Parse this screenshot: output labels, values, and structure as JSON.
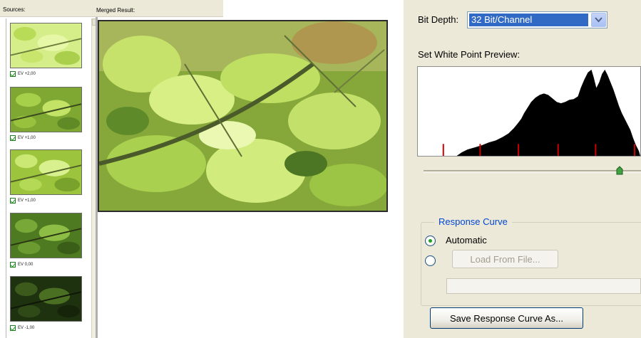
{
  "sources_panel": {
    "sources_label": "Sources:",
    "merged_label": "Merged Result:",
    "thumbnails": [
      {
        "ev_label": "EV +2,00",
        "checked": true,
        "exposure": "brightest"
      },
      {
        "ev_label": "EV +1,00",
        "checked": true,
        "exposure": "bright"
      },
      {
        "ev_label": "EV +1,00",
        "checked": true,
        "exposure": "bright"
      },
      {
        "ev_label": "EV 0,00",
        "checked": true,
        "exposure": "normal"
      },
      {
        "ev_label": "EV -1,00",
        "checked": true,
        "exposure": "dark"
      }
    ]
  },
  "options": {
    "bit_depth_label": "Bit Depth:",
    "bit_depth_value": "32 Bit/Channel",
    "white_point_label": "Set White Point Preview:",
    "white_point_fraction": 0.9,
    "response_curve": {
      "title": "Response Curve",
      "automatic_label": "Automatic",
      "automatic_selected": true,
      "load_from_file_label": "Load From File...",
      "load_from_file_enabled": false,
      "file_path_value": "",
      "save_button_label": "Save Response Curve As..."
    }
  },
  "colors": {
    "dialog_bg": "#ece9d8",
    "selection_blue": "#316ac5",
    "group_title_blue": "#0046d5",
    "histogram_fill": "#000000",
    "histogram_markers": "#cc0000",
    "foliage_light": "#c7e26a",
    "foliage_dark": "#3f5d1c"
  },
  "icons": {
    "dropdown_arrow": "chevron-down-icon",
    "slider_thumb": "slider-thumb-icon",
    "ev_checkbox": "checkbox-checked-icon"
  }
}
